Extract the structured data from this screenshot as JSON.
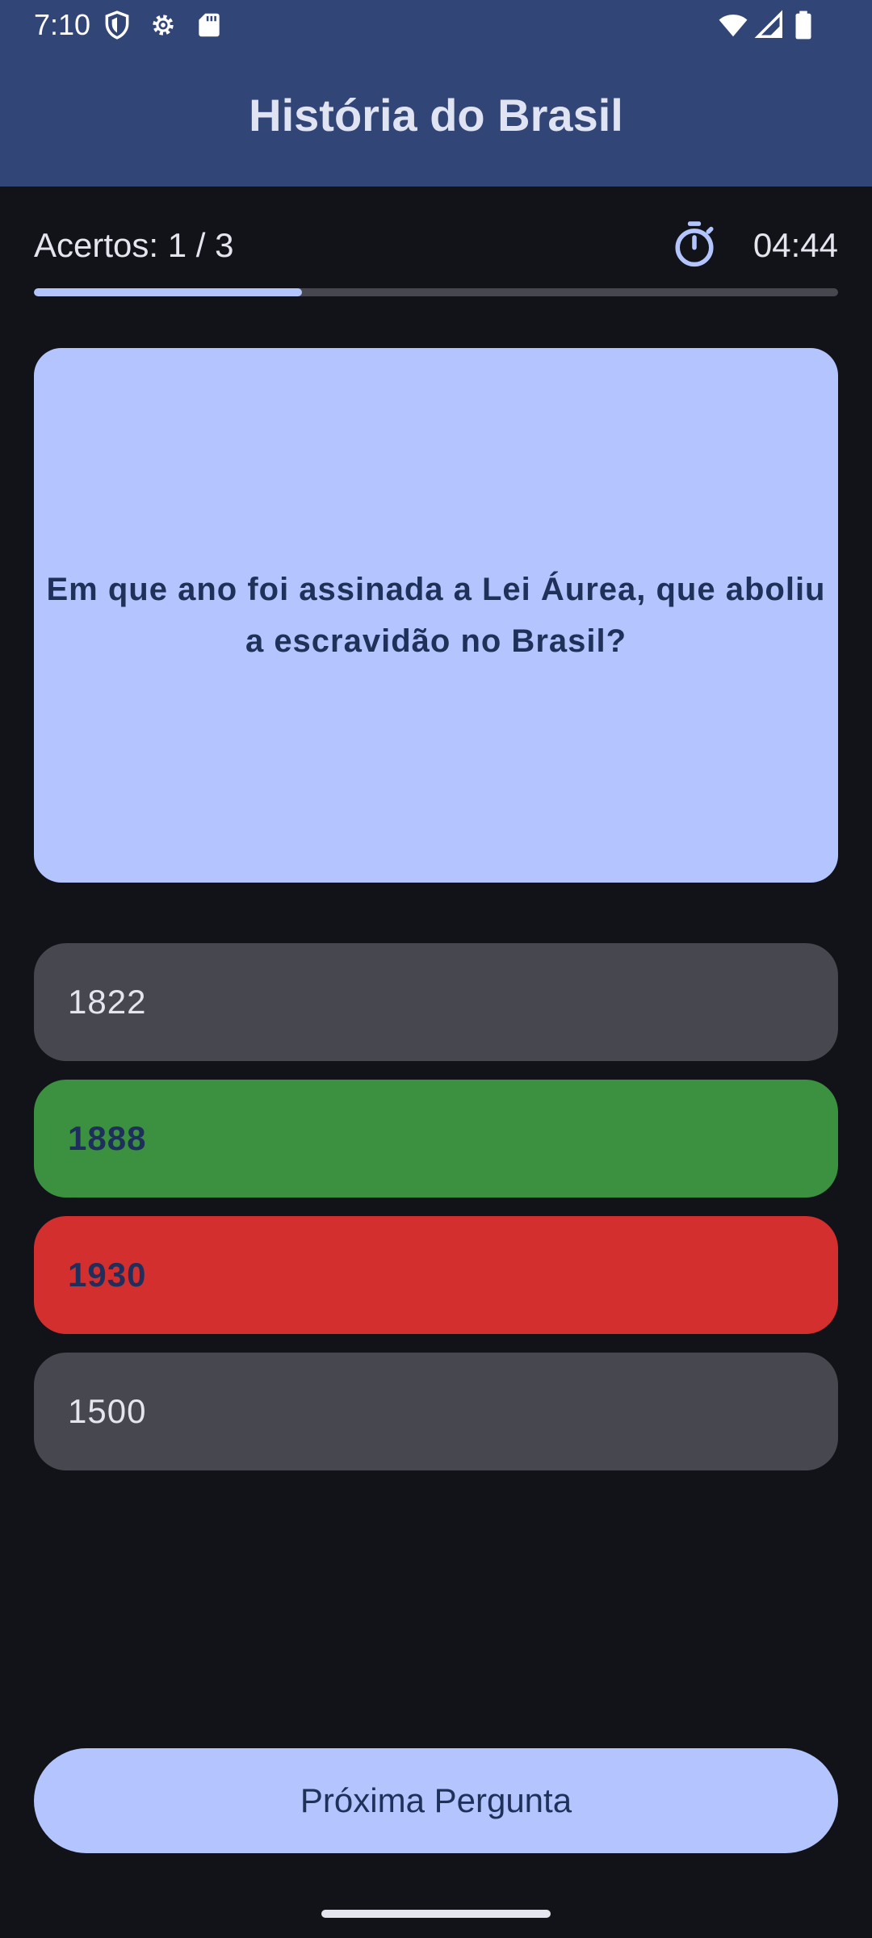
{
  "status_bar": {
    "time": "7:10",
    "left_icons": [
      "shield-icon",
      "gear-icon",
      "sd-card-icon"
    ],
    "right_icons": [
      "wifi-icon",
      "signal-icon",
      "battery-icon"
    ]
  },
  "app_bar": {
    "title": "História do Brasil"
  },
  "score": {
    "label": "Acertos: 1 / 3"
  },
  "timer": {
    "icon": "stopwatch-icon",
    "value": "04:44"
  },
  "progress": {
    "fraction": 0.333
  },
  "question": {
    "text": "Em que ano foi assinada a Lei Áurea, que aboliu a escravidão no Brasil?"
  },
  "answers": [
    {
      "label": "1822",
      "state": "neutral"
    },
    {
      "label": "1888",
      "state": "correct"
    },
    {
      "label": "1930",
      "state": "wrong"
    },
    {
      "label": "1500",
      "state": "neutral"
    }
  ],
  "next_button": {
    "label": "Próxima Pergunta"
  },
  "colors": {
    "app_bar": "#324577",
    "background": "#121318",
    "accent": "#b3c4ff",
    "neutral_answer": "#46474f",
    "correct_answer": "#3b913f",
    "wrong_answer": "#d32f2f"
  }
}
